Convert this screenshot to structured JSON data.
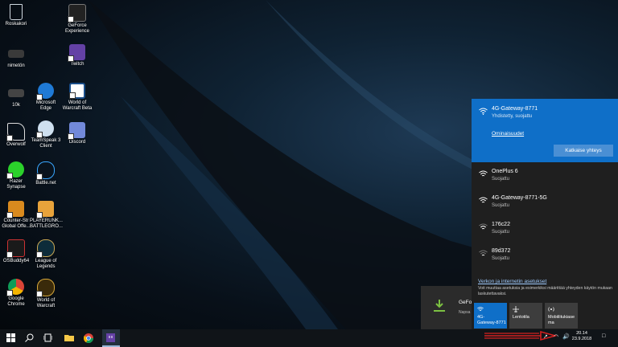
{
  "desktop": {
    "icons": [
      {
        "label": "Roskakori"
      },
      {
        "label": "GeForce Experience"
      },
      {
        "label": "nimetön"
      },
      {
        "label": "Twitch"
      },
      {
        "label": "10k"
      },
      {
        "label": "Microsoft Edge"
      },
      {
        "label": "World of Warcraft Beta"
      },
      {
        "label": "Overwolf"
      },
      {
        "label": "TeamSpeak 3 Client"
      },
      {
        "label": "Discord"
      },
      {
        "label": "Razer Synapse"
      },
      {
        "label": "Battle.net"
      },
      {
        "label": "Counter-Str Global Offe..."
      },
      {
        "label": "PLAYERUNK... BATTLEGRO..."
      },
      {
        "label": "OSBuddy64"
      },
      {
        "label": "League of Legends"
      },
      {
        "label": "Google Chrome"
      },
      {
        "label": "World of Warcraft"
      }
    ]
  },
  "network_flyout": {
    "connected": {
      "name": "4G-Gateway-8771",
      "status": "Yhdistetty, suojattu",
      "properties_link": "Ominaisuudet",
      "disconnect_label": "Katkaise yhteys"
    },
    "networks": [
      {
        "name": "OnePlus 6",
        "status": "Suojattu"
      },
      {
        "name": "4G-Gateway-8771-5G",
        "status": "Suojattu"
      },
      {
        "name": "176c22",
        "status": "Suojattu"
      },
      {
        "name": "89d372",
        "status": "Suojattu"
      }
    ],
    "settings_link": "Verkon ja internetin asetukset",
    "settings_desc": "Voit muuttaa asetuksia ja esimerkiksi määrittää yhteyden käytön mukaan laskutettavaksi.",
    "quick_actions": [
      {
        "label": "4G-\nGateway-8771",
        "active": true
      },
      {
        "label": "Lentotila",
        "active": false
      },
      {
        "label": "Mobiilitukiase\nma",
        "active": false
      }
    ]
  },
  "toast": {
    "title": "GeFor",
    "subtitle": "Napsa"
  },
  "taskbar": {
    "time": "20.14",
    "date": "23.9.2018"
  },
  "colors": {
    "accent": "#0f6fc8",
    "flyout_bg": "#1f1f1f",
    "taskbar_bg": "#101418",
    "annotation": "#d42020"
  }
}
